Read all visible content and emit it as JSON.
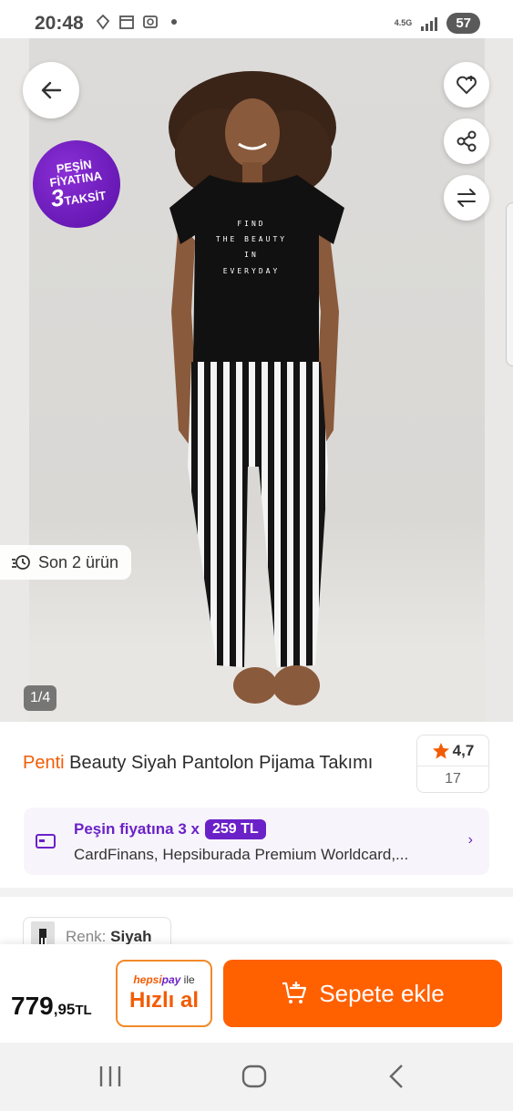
{
  "status_bar": {
    "time": "20:48",
    "network": "4.5G",
    "battery": "57",
    "icons": [
      "location-icon",
      "calendar-icon",
      "screenshot-icon"
    ]
  },
  "gallery": {
    "promo_badge": {
      "line1": "PEŞİN",
      "line2": "FİYATINA",
      "line3_number": "3",
      "line3_text": "TAKSİT"
    },
    "stock_label": "Son 2 ürün",
    "page_indicator": "1/4",
    "shirt_print": [
      "FIND",
      "THE BEAUTY",
      "IN",
      "EVERYDAY"
    ],
    "buttons": [
      "back-icon",
      "favorite-icon",
      "share-icon",
      "compare-icon"
    ]
  },
  "product": {
    "brand": "Penti",
    "name": "Beauty Siyah Pantolon Pijama Takımı",
    "rating": "4,7",
    "review_count": "17"
  },
  "installment": {
    "label": "Peşin fiyatına 3 x",
    "amount": "259 TL",
    "cards": "CardFinans, Hepsiburada Premium Worldcard,..."
  },
  "color": {
    "label": "Renk:",
    "value": "Siyah"
  },
  "buy_bar": {
    "price_main": "779",
    "price_cents": ",95",
    "currency": "TL",
    "quick_pay_brand_hepsi": "hepsi",
    "quick_pay_brand_pay": "pay",
    "quick_pay_suffix": " ile",
    "quick_pay_label": "Hızlı al",
    "add_to_cart": "Sepete ekle"
  },
  "colors": {
    "brand_orange": "#ff6000",
    "purple": "#6b21c8"
  }
}
